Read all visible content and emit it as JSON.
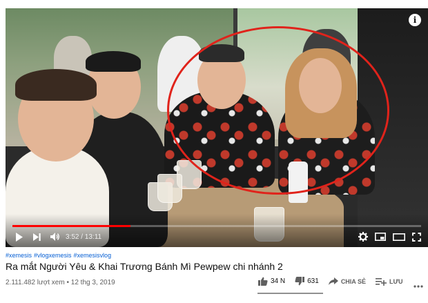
{
  "video": {
    "info_icon": "info-icon",
    "progress": 0.289,
    "current_time": "3:52",
    "duration": "13:11",
    "time_display": "3:52 / 13:11",
    "accent_color": "#ff0000",
    "controls": {
      "play": "play-icon",
      "next": "next-icon",
      "volume": "volume-icon",
      "settings": "gear-icon",
      "miniplayer": "miniplayer-icon",
      "theater": "theater-icon",
      "fullscreen": "fullscreen-icon"
    }
  },
  "hashtags": [
    "#xemesis",
    "#vlogxemesis",
    "#xemesisvlog"
  ],
  "title": "Ra mắt Người Yêu & Khai Trương Bánh Mì Pewpew chi nhánh 2",
  "meta": "2.111.482 lượt xem • 12 thg 3, 2019",
  "actions": {
    "likes": "34 N",
    "dislikes": "631",
    "share": "CHIA SẺ",
    "save": "LƯU"
  },
  "link_color": "#065fd4"
}
